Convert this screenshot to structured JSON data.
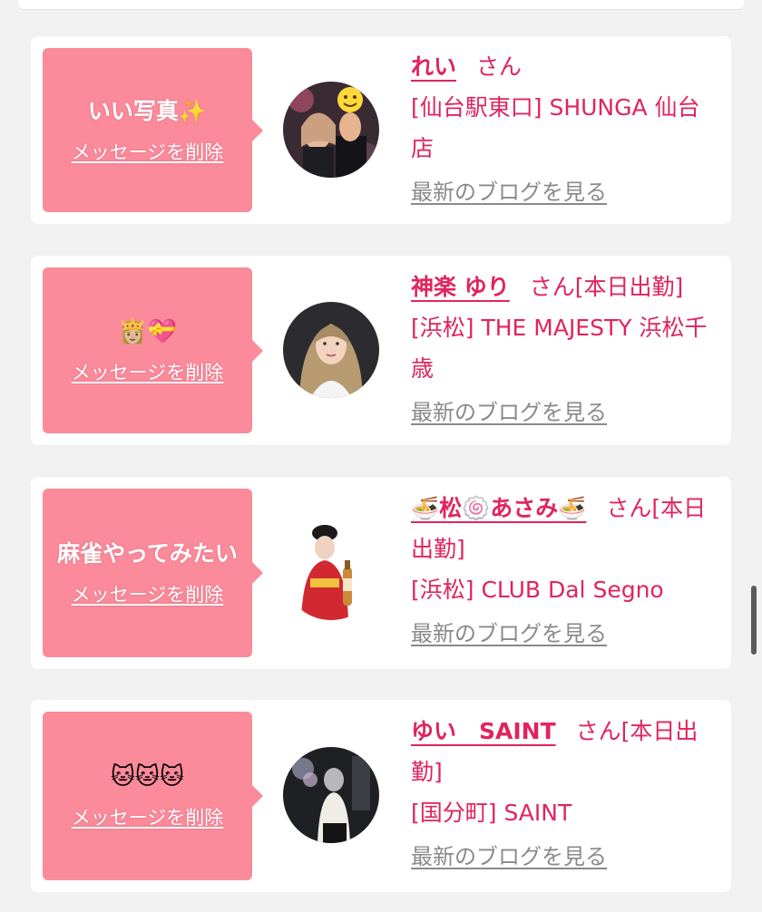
{
  "delete_label": "メッセージを削除",
  "blog_label": "最新のブログを見る",
  "san_suffix": "さん",
  "cards": [
    {
      "message": "いい写真✨",
      "name": "れい",
      "status": "",
      "shop": "[仙台駅東口] SHUNGA 仙台店"
    },
    {
      "message": "👸🏼💝",
      "name": "神楽 ゆり",
      "status": "[本日出勤]",
      "shop": "[浜松] THE MAJESTY 浜松千歳"
    },
    {
      "message": "麻雀やってみたい",
      "name": "🍜松🍥あさみ🍜",
      "status": "[本日出勤]",
      "shop": "[浜松] CLUB Dal Segno"
    },
    {
      "message": "🐱🐱🐱",
      "name": "ゆい　SAINT",
      "status": "[本日出勤]",
      "shop": "[国分町] SAINT"
    }
  ],
  "colors": {
    "accent_pink": "#e0245e",
    "message_box": "#fb8a9b",
    "link_gray": "#8a8a8a",
    "background": "#f1f1f1"
  },
  "icons": [
    "avatar-photo"
  ]
}
